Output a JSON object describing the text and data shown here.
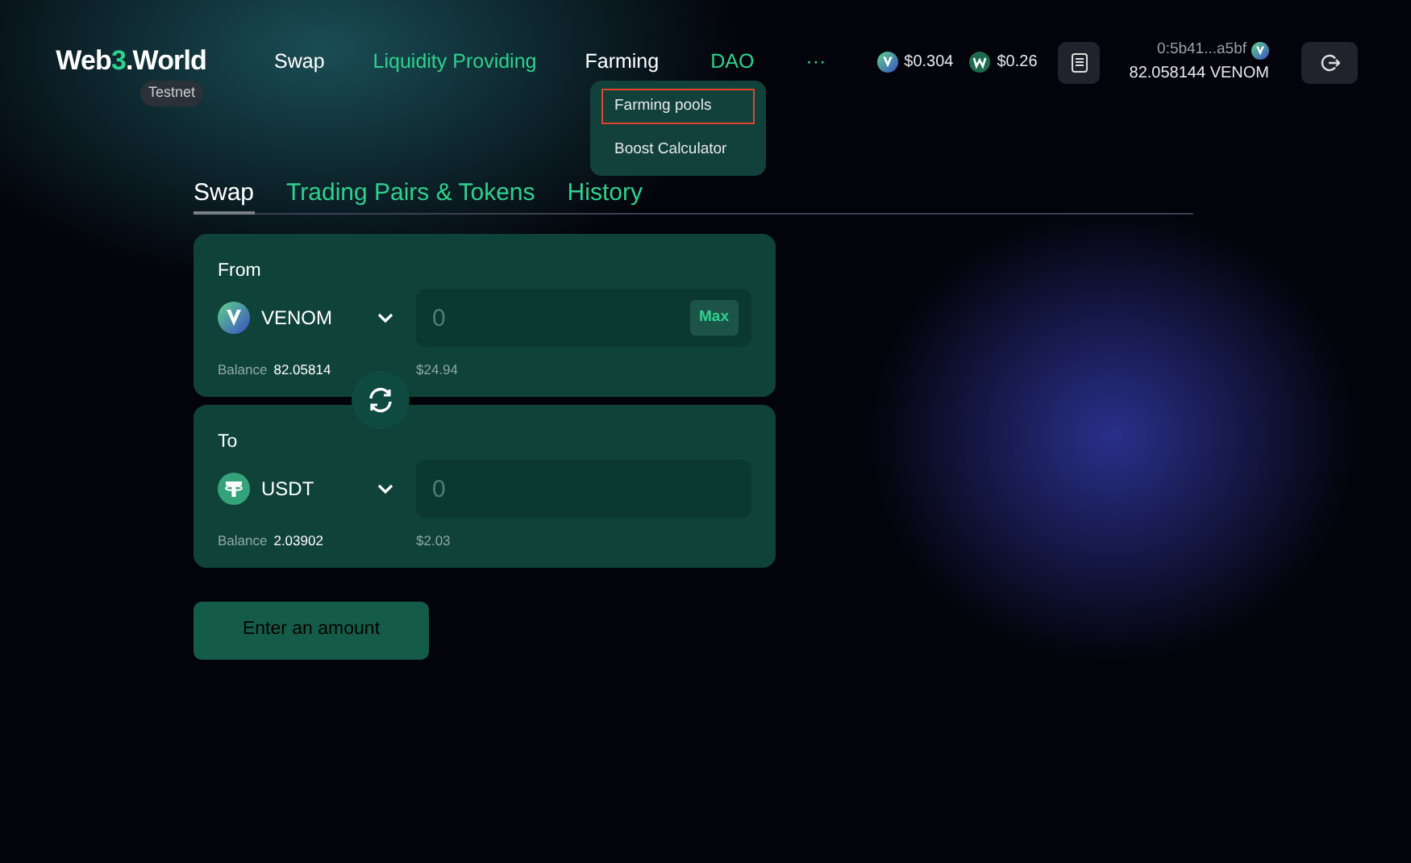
{
  "logo": {
    "parts": [
      {
        "text": "Web",
        "accent": false
      },
      {
        "text": "3",
        "accent": true
      },
      {
        "text": ".World",
        "accent": false
      }
    ],
    "badge": "Testnet"
  },
  "nav": [
    {
      "label": "Swap",
      "selected": true
    },
    {
      "label": "Liquidity Providing",
      "selected": false
    },
    {
      "label": "Farming",
      "selected": true
    },
    {
      "label": "DAO",
      "selected": false
    },
    {
      "label": "···",
      "selected": false
    }
  ],
  "farming_menu": [
    {
      "label": "Farming pools",
      "highlighted": true
    },
    {
      "label": "Boost Calculator",
      "highlighted": false
    }
  ],
  "prices": [
    {
      "kind": "venom",
      "value": "$0.304"
    },
    {
      "kind": "w",
      "value": "$0.26"
    }
  ],
  "wallet": {
    "address": "0:5b41...a5bf",
    "balance": "82.058144 VENOM"
  },
  "tabs": [
    {
      "label": "Swap",
      "selected": true
    },
    {
      "label": "Trading Pairs & Tokens",
      "selected": false
    },
    {
      "label": "History",
      "selected": false
    }
  ],
  "from": {
    "label": "From",
    "token": "VENOM",
    "kind": "venom",
    "amount_placeholder": "0",
    "max": "Max",
    "balance_label": "Balance",
    "balance": "82.05814",
    "usd": "$24.94"
  },
  "to": {
    "label": "To",
    "token": "USDT",
    "kind": "usdt",
    "amount_placeholder": "0",
    "balance_label": "Balance",
    "balance": "2.03902",
    "usd": "$2.03"
  },
  "submit": {
    "label": "Enter an amount",
    "disabled": true
  }
}
